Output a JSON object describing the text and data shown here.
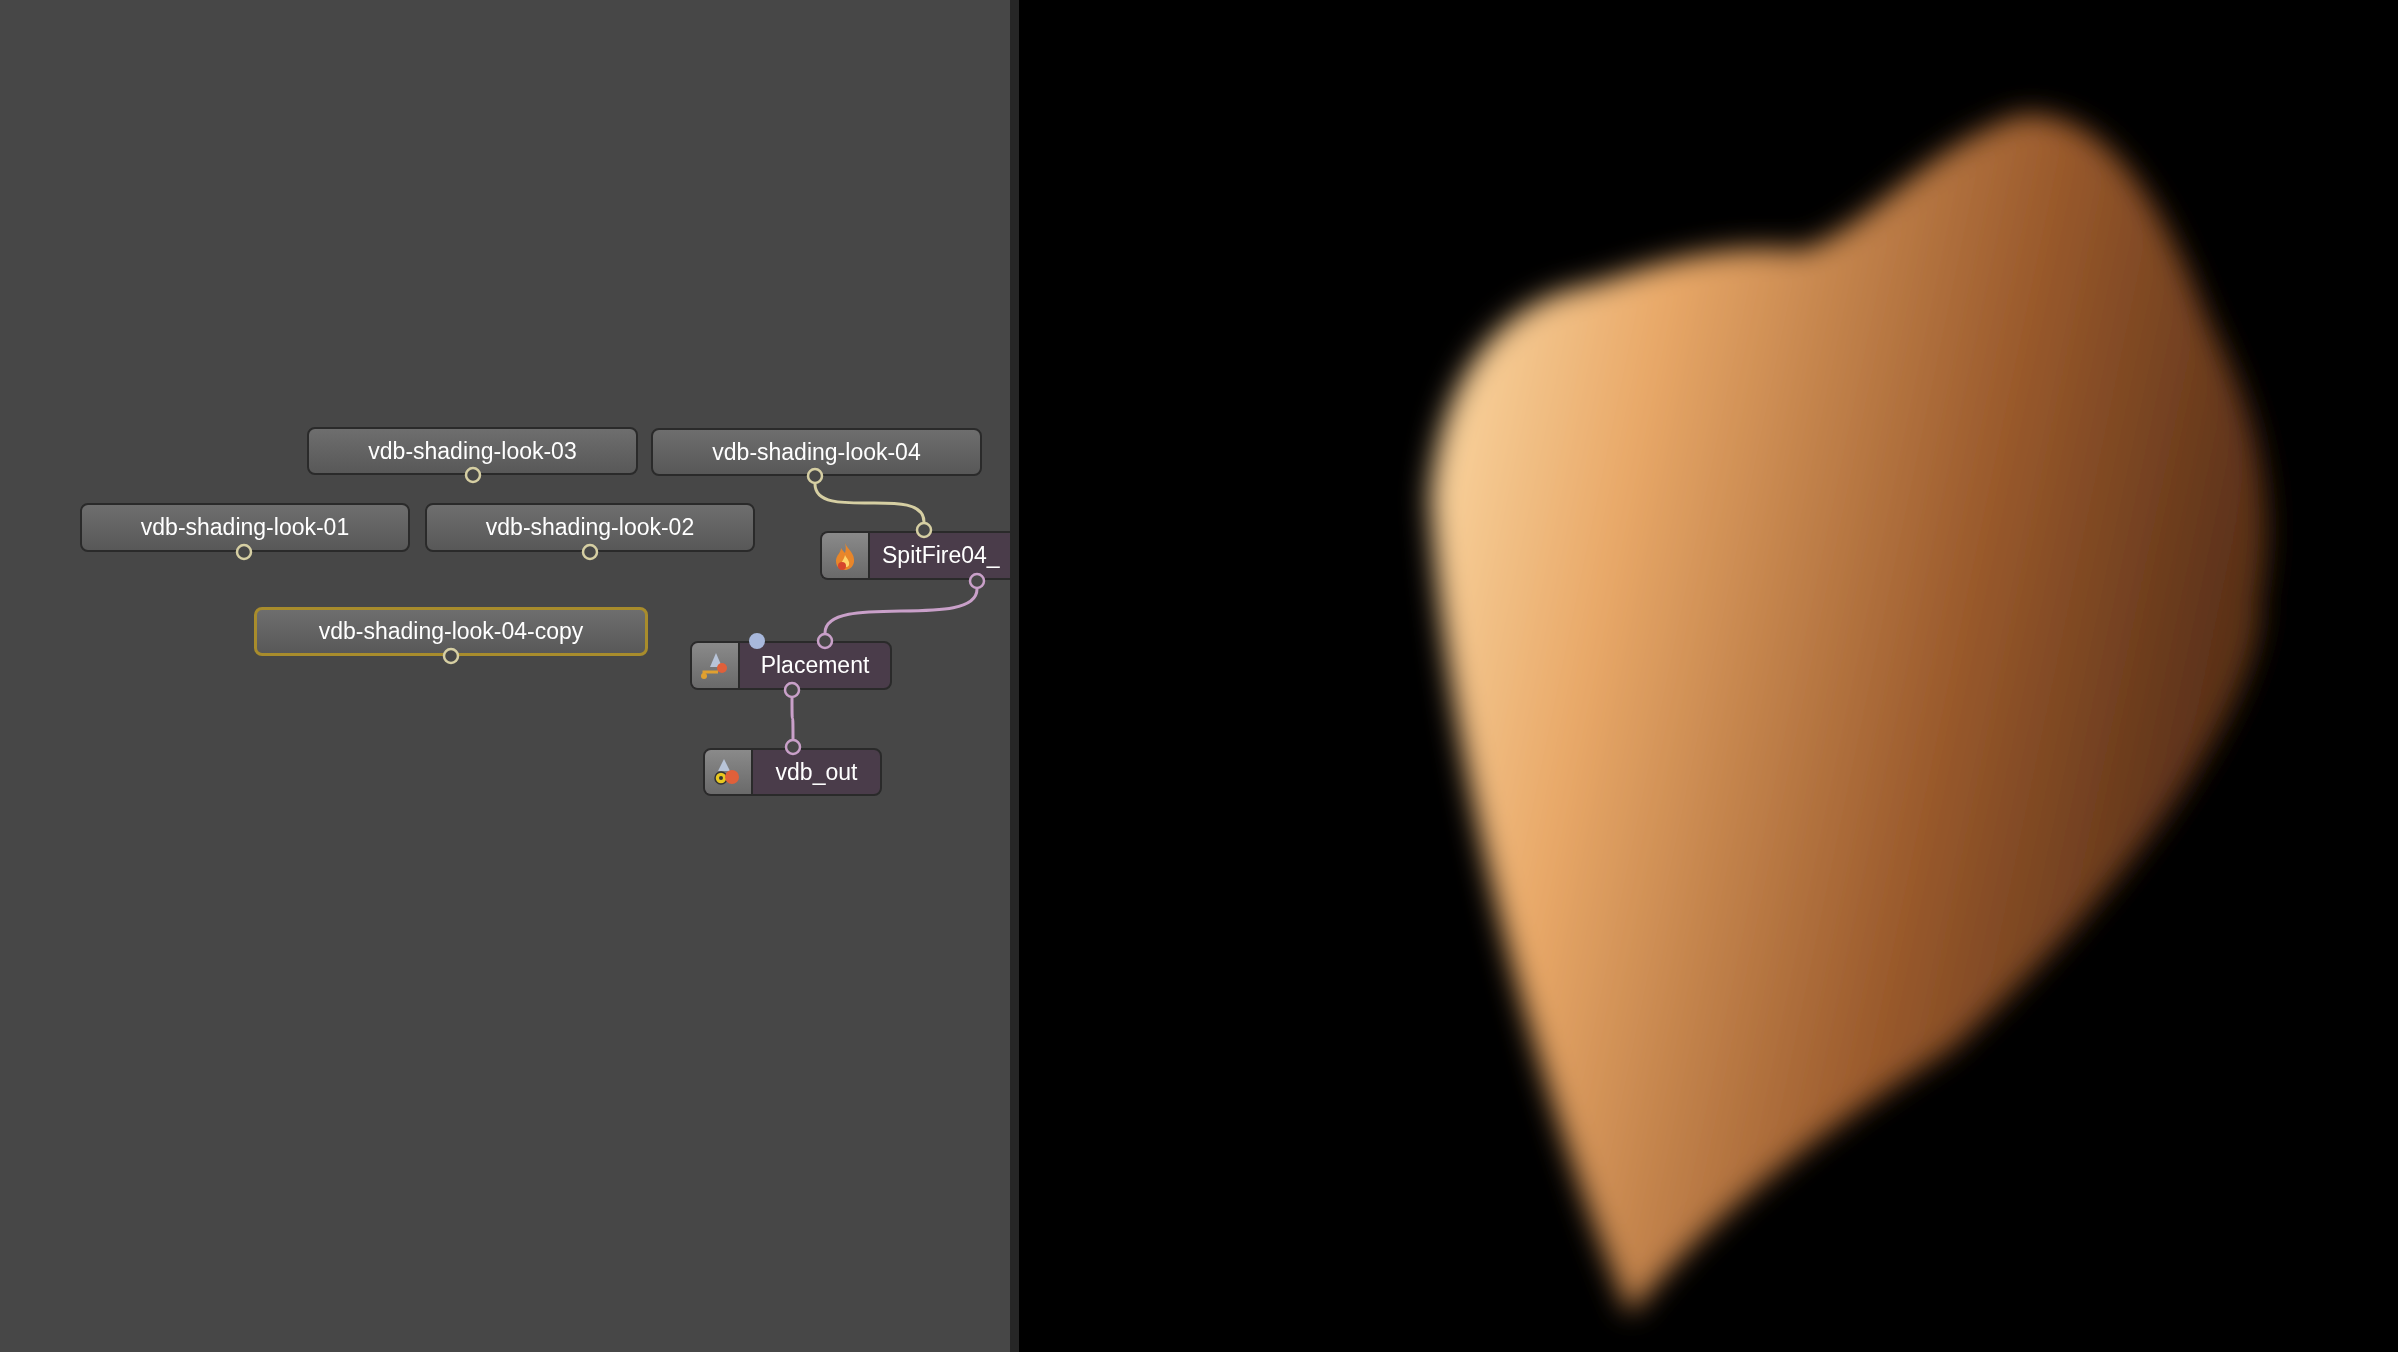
{
  "node_graph": {
    "nodes": [
      {
        "label": "vdb-shading-look-03",
        "kind": "look",
        "selected": false,
        "flagged": false
      },
      {
        "label": "vdb-shading-look-04",
        "kind": "look",
        "selected": false,
        "flagged": false
      },
      {
        "label": "vdb-shading-look-01",
        "kind": "look",
        "selected": false,
        "flagged": false
      },
      {
        "label": "vdb-shading-look-02",
        "kind": "look",
        "selected": false,
        "flagged": false
      },
      {
        "label": "vdb-shading-look-04-copy",
        "kind": "look",
        "selected": true,
        "flagged": false
      },
      {
        "label": "SpitFire04_",
        "kind": "fire",
        "selected": false,
        "flagged": false
      },
      {
        "label": "Placement",
        "kind": "placement",
        "selected": false,
        "flagged": true
      },
      {
        "label": "vdb_out",
        "kind": "output",
        "selected": false,
        "flagged": false
      }
    ]
  }
}
